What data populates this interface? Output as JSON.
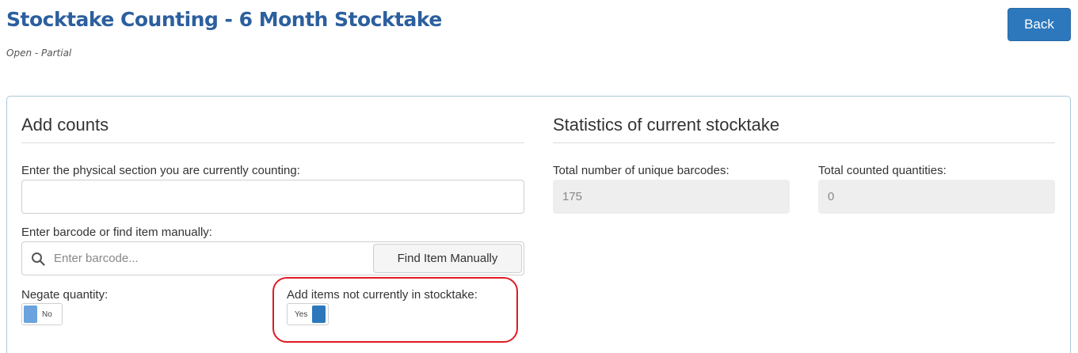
{
  "header": {
    "title": "Stocktake Counting - 6 Month Stocktake",
    "status": "Open - Partial",
    "back_label": "Back"
  },
  "add_counts": {
    "title": "Add counts",
    "section_label": "Enter the physical section you are currently counting:",
    "section_value": "",
    "barcode_label": "Enter barcode or find item manually:",
    "barcode_placeholder": "Enter barcode...",
    "find_button_label": "Find Item Manually",
    "negate": {
      "label": "Negate quantity:",
      "state": "No"
    },
    "add_items": {
      "label": "Add items not currently in stocktake:",
      "state": "Yes"
    }
  },
  "statistics": {
    "title": "Statistics of current stocktake",
    "unique_barcodes_label": "Total number of unique barcodes:",
    "unique_barcodes_value": "175",
    "counted_quantities_label": "Total counted quantities:",
    "counted_quantities_value": "0"
  },
  "colors": {
    "title": "#2c5f9e",
    "button": "#2d78bd",
    "toggle_off_knob": "#6aa3dd",
    "toggle_on_knob": "#2d78bd",
    "highlight": "#e01b24"
  },
  "icons": {
    "search": "search-icon"
  }
}
